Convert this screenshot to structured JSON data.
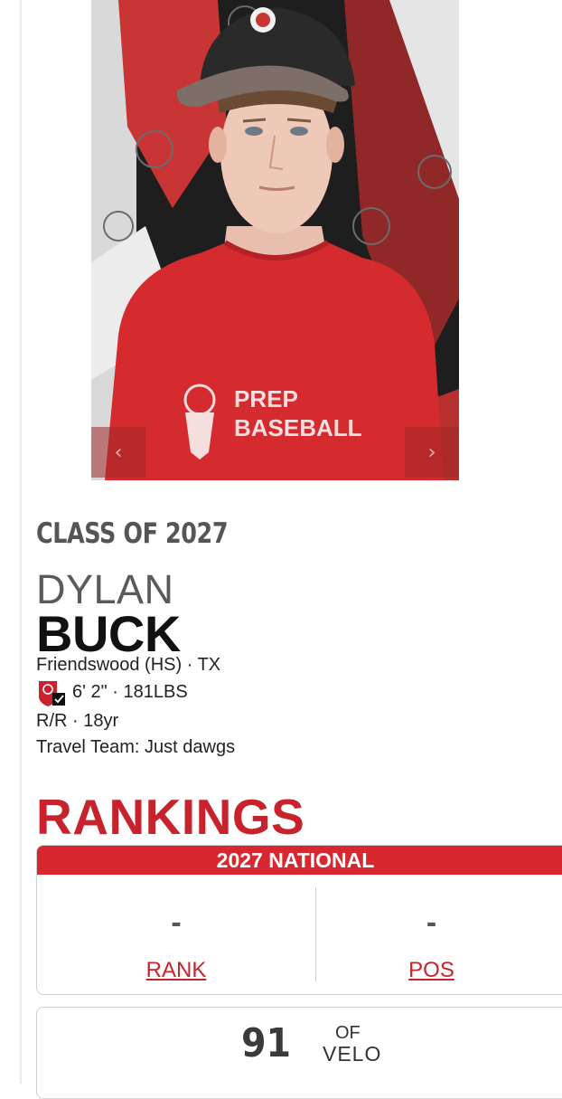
{
  "carousel": {
    "prev_icon": "chevron-left-icon",
    "next_icon": "chevron-right-icon",
    "prev_glyph": "‹",
    "next_glyph": "›",
    "shirt_text_line1": "PREP",
    "shirt_text_line2": "BASEBALL",
    "backdrop_brand": "PREP BASEBALL"
  },
  "player": {
    "class_label": "CLASS OF 2027",
    "first_name": "DYLAN",
    "last_name": "BUCK",
    "school_line": "Friendswood (HS) · TX",
    "size_line": "6' 2\" · 181LBS",
    "bats_line": "R/R · 18yr",
    "travel_team_line": "Travel Team: Just dawgs",
    "badge_icon": "verified-shield-icon"
  },
  "rankings": {
    "title": "RANKINGS",
    "header": "2027 NATIONAL",
    "rank_value": "-",
    "rank_label": "RANK",
    "pos_value": "-",
    "pos_label": "POS"
  },
  "velo": {
    "value": "91",
    "position": "OF",
    "label": "VELO"
  },
  "colors": {
    "accent_red": "#c8232c",
    "header_red": "#d7282f",
    "shirt_red": "#d52a2e"
  }
}
